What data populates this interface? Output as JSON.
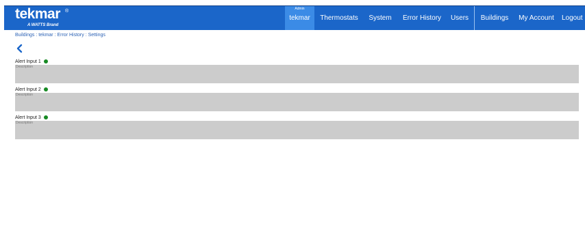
{
  "header": {
    "logo_text": "tekmar",
    "logo_registered": "®",
    "logo_subtitle": "A WATTS Brand",
    "admin_tag": "Admin",
    "nav": [
      {
        "label": "tekmar"
      },
      {
        "label": "Thermostats"
      },
      {
        "label": "System"
      },
      {
        "label": "Error History"
      },
      {
        "label": "Users"
      },
      {
        "label": "Buildings"
      },
      {
        "label": "My Account"
      },
      {
        "label": "Logout"
      }
    ]
  },
  "breadcrumb": "Buildings : tekmar : Error History : Settings",
  "icons": {
    "back": "chevron-left-icon",
    "status": "green-dot-icon"
  },
  "colors": {
    "nav_bg": "#1b66c9",
    "nav_active": "#3b8be6",
    "status_ok": "#178a24",
    "field_bg": "#cccccc"
  },
  "alerts": [
    {
      "label": "Alert Input 1",
      "description_placeholder": "Description"
    },
    {
      "label": "Alert Input 2",
      "description_placeholder": "Description"
    },
    {
      "label": "Alert Input 3",
      "description_placeholder": "Description"
    }
  ]
}
